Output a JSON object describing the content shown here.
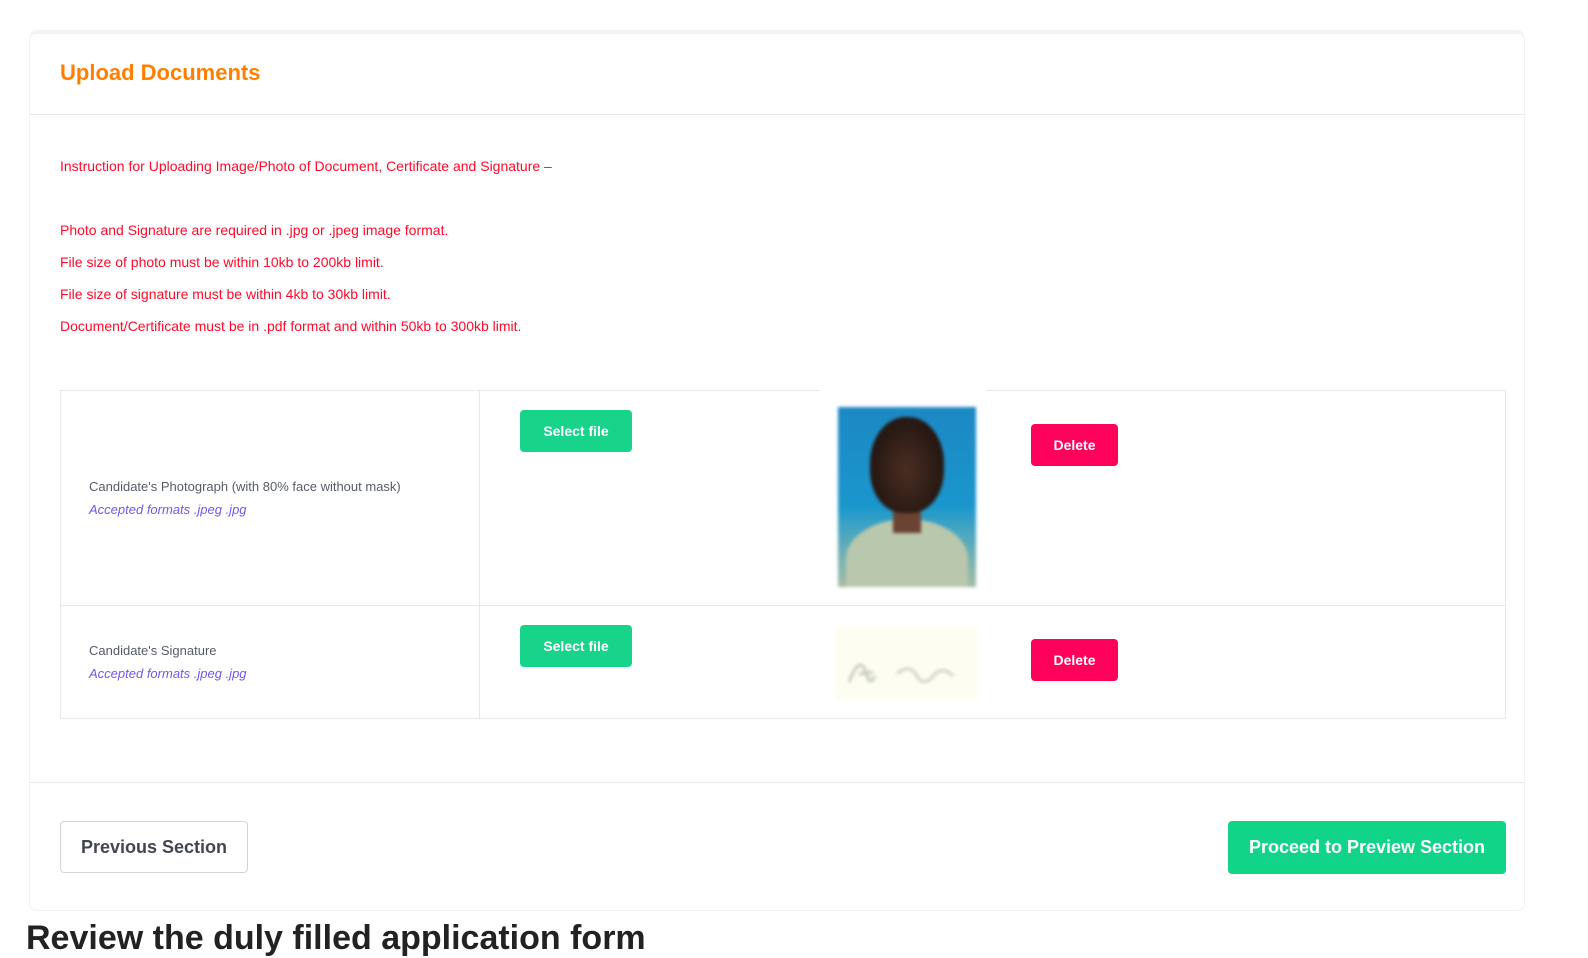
{
  "upload_section": {
    "title": "Upload Documents",
    "instructions": {
      "heading": "Instruction for Uploading Image/Photo of Document, Certificate and Signature –",
      "lines": [
        "Photo and Signature are required in .jpg or .jpeg image format.",
        "File size of photo must be within 10kb to 200kb limit.",
        "File size of signature must be within 4kb to 30kb limit.",
        "Document/Certificate must be in .pdf format and within 50kb to 300kb limit."
      ]
    },
    "documents": [
      {
        "label": "Candidate's Photograph (with 80% face without mask)",
        "formats": "Accepted formats .jpeg .jpg",
        "select_label": "Select file",
        "delete_label": "Delete"
      },
      {
        "label": "Candidate's Signature",
        "formats": "Accepted formats .jpeg .jpg",
        "select_label": "Select file",
        "delete_label": "Delete"
      }
    ],
    "footer": {
      "previous_label": "Previous Section",
      "proceed_label": "Proceed to Preview Section"
    }
  },
  "below_heading": "Review the duly filled application form",
  "colors": {
    "title_orange": "#ff7f00",
    "instruction_red": "#ff0a2a",
    "select_green": "#17d48a",
    "delete_pink": "#ff005a",
    "format_purple": "#7356f1"
  }
}
